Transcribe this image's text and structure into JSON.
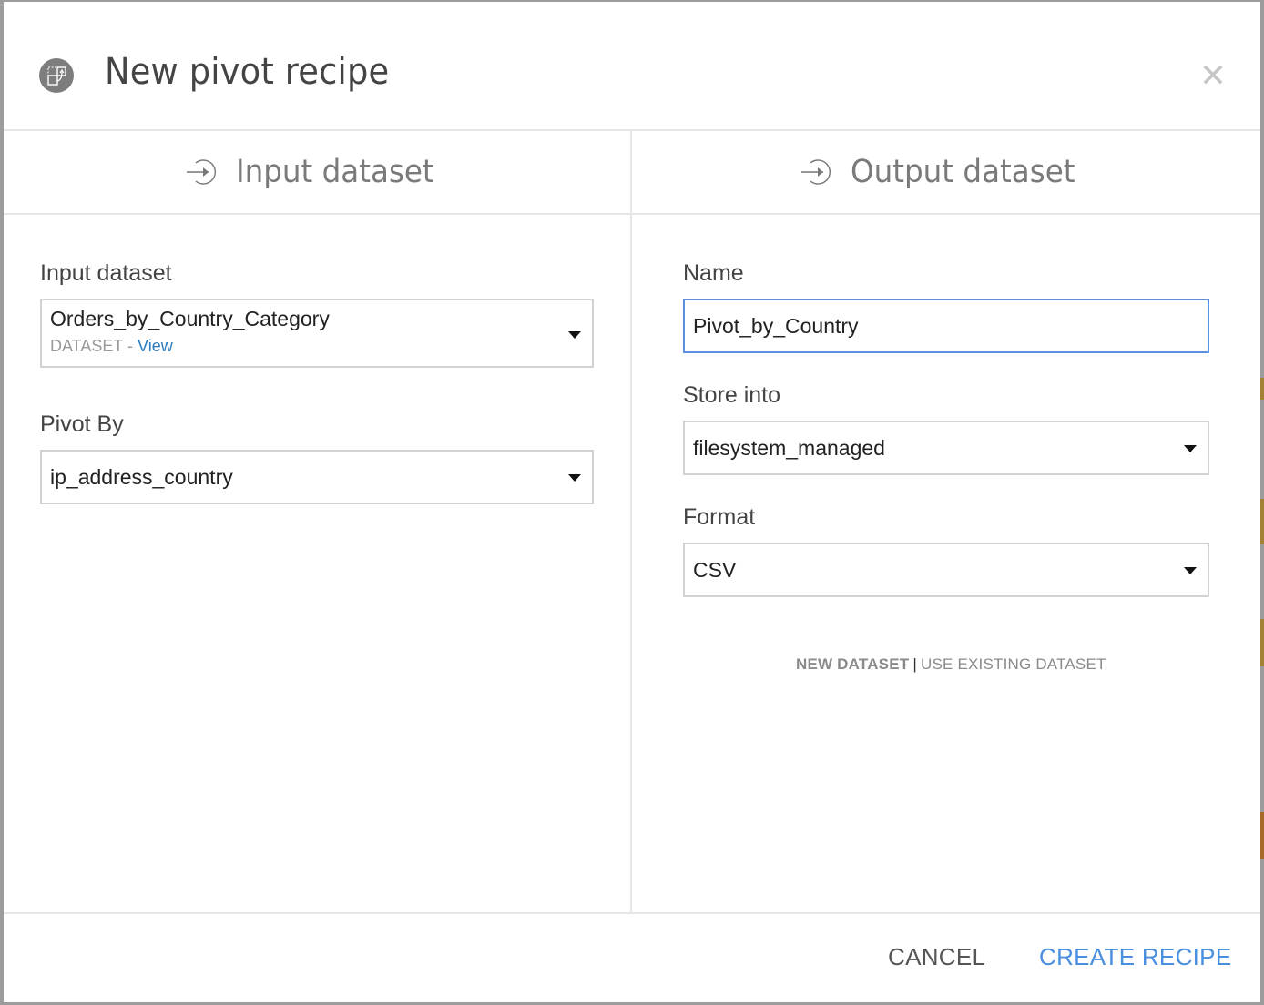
{
  "dialog": {
    "title": "New pivot recipe",
    "icon": "pivot-recipe-icon",
    "close_icon": "close-icon"
  },
  "columns": {
    "input": {
      "title": "Input dataset",
      "icon": "arrow-in-circle-icon"
    },
    "output": {
      "title": "Output dataset",
      "icon": "arrow-in-circle-icon"
    }
  },
  "input_form": {
    "input_dataset": {
      "label": "Input dataset",
      "value": "Orders_by_Country_Category",
      "meta_type": "DATASET",
      "meta_sep": " - ",
      "view_link": "View"
    },
    "pivot_by": {
      "label": "Pivot By",
      "value": "ip_address_country"
    }
  },
  "output_form": {
    "name": {
      "label": "Name",
      "value": "Pivot_by_Country"
    },
    "store_into": {
      "label": "Store into",
      "value": "filesystem_managed"
    },
    "format": {
      "label": "Format",
      "value": "CSV"
    },
    "mode_new": "NEW DATASET",
    "mode_separator": "|",
    "mode_existing": "USE EXISTING DATASET"
  },
  "footer": {
    "cancel_label": "CANCEL",
    "create_label": "CREATE RECIPE"
  },
  "colors": {
    "accent": "#4a8ee0",
    "link": "#2b7bbf",
    "focus_border": "#5b8fe0"
  }
}
